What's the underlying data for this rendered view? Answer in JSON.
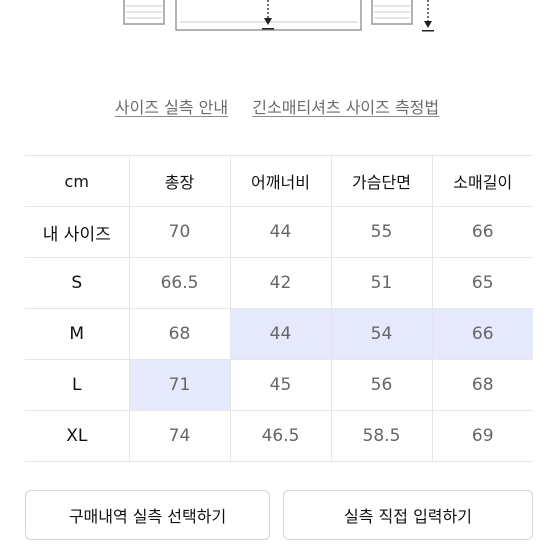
{
  "links": {
    "actual_size_guide": "사이즈 실측 안내",
    "measure_guide": "긴소매티셔츠 사이즈 측정법"
  },
  "table": {
    "headers": [
      "cm",
      "총장",
      "어깨너비",
      "가슴단면",
      "소매길이"
    ],
    "rows": [
      {
        "label": "내 사이즈",
        "values": [
          "70",
          "44",
          "55",
          "66"
        ]
      },
      {
        "label": "S",
        "values": [
          "66.5",
          "42",
          "51",
          "65"
        ]
      },
      {
        "label": "M",
        "values": [
          "68",
          "44",
          "54",
          "66"
        ]
      },
      {
        "label": "L",
        "values": [
          "71",
          "45",
          "56",
          "68"
        ]
      },
      {
        "label": "XL",
        "values": [
          "74",
          "46.5",
          "58.5",
          "69"
        ]
      }
    ],
    "highlight_color": "#e6e8fb"
  },
  "buttons": {
    "select_purchase": "구매내역 실측 선택하기",
    "direct_input": "실측 직접 입력하기"
  }
}
